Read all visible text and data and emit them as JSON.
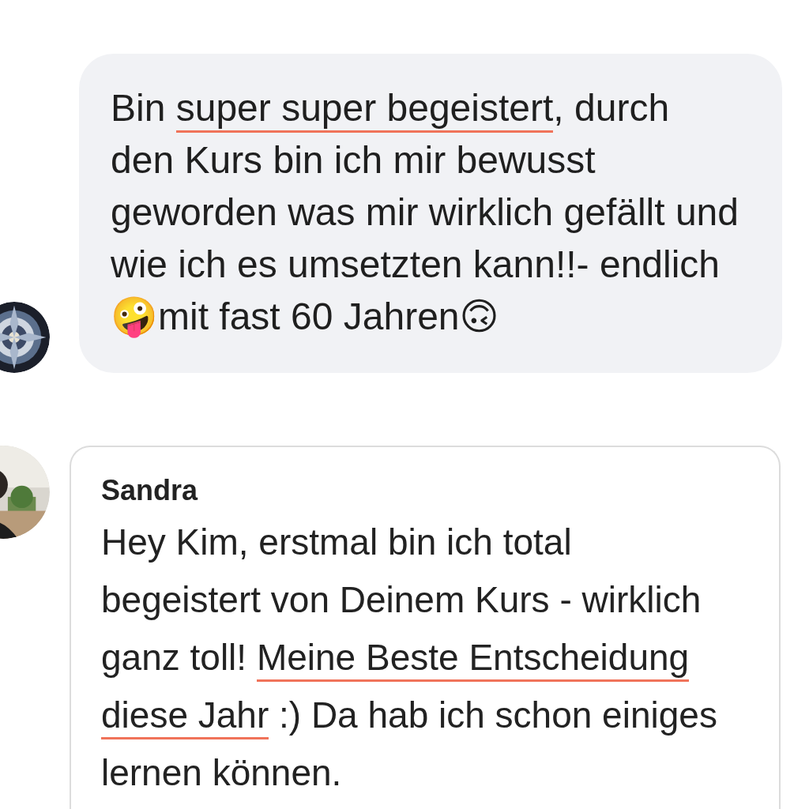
{
  "messages": [
    {
      "kind": "bubble",
      "text": [
        {
          "text": "Bin ",
          "underlined": false
        },
        {
          "text": "super super begeistert",
          "underlined": true
        },
        {
          "text": ", durch den Kurs bin ich mir bewusst geworden was mir wirklich gefällt und wie ich es umsetzten kann!!- endlich🤪mit fast 60 Jahren🙃",
          "underlined": false
        }
      ]
    },
    {
      "kind": "card",
      "author": "Sandra",
      "text": [
        {
          "text": "Hey Kim, erstmal bin ich total begeistert von Deinem Kurs - wirklich ganz toll! ",
          "underlined": false
        },
        {
          "text": "Meine Beste Entscheidung diese Jahr",
          "underlined": true
        },
        {
          "text": " :) Da hab ich schon einiges lernen können.",
          "underlined": false
        }
      ]
    }
  ]
}
